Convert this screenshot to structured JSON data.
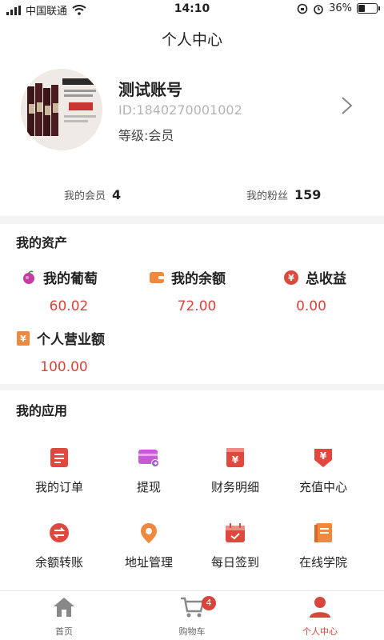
{
  "status_bar": {
    "carrier": "中国联通",
    "time": "14:10",
    "battery": "36%",
    "battery_level": 0.36
  },
  "header": {
    "title": "个人中心"
  },
  "profile": {
    "name": "测试账号",
    "id": "ID:1840270001002",
    "level": "等级:会员",
    "members_label": "我的会员",
    "members_count": "4",
    "fans_label": "我的粉丝",
    "fans_count": "159"
  },
  "assets": {
    "title": "我的资产",
    "items": [
      {
        "label": "我的葡萄",
        "value": "60.02",
        "icon": "grape-icon",
        "color": "#c23ea3"
      },
      {
        "label": "我的余额",
        "value": "72.00",
        "icon": "wallet-icon",
        "color": "#f0883e"
      },
      {
        "label": "总收益",
        "value": "0.00",
        "icon": "yen-coin-icon",
        "color": "#e0483d"
      },
      {
        "label": "个人营业额",
        "value": "100.00",
        "icon": "yen-tag-icon",
        "color": "#f0883e"
      }
    ]
  },
  "apps": {
    "title": "我的应用",
    "items": [
      {
        "label": "我的订单",
        "icon": "order-list-icon"
      },
      {
        "label": "提现",
        "icon": "withdraw-card-icon"
      },
      {
        "label": "财务明细",
        "icon": "finance-detail-icon"
      },
      {
        "label": "充值中心",
        "icon": "recharge-icon"
      },
      {
        "label": "余额转账",
        "icon": "transfer-icon"
      },
      {
        "label": "地址管理",
        "icon": "location-pin-icon"
      },
      {
        "label": "每日签到",
        "icon": "calendar-check-icon"
      },
      {
        "label": "在线学院",
        "icon": "book-icon"
      }
    ]
  },
  "tabbar": {
    "items": [
      {
        "label": "首页",
        "icon": "home-icon"
      },
      {
        "label": "购物车",
        "icon": "cart-icon",
        "badge": "4"
      },
      {
        "label": "个人中心",
        "icon": "user-icon",
        "active": true
      }
    ]
  },
  "colors": {
    "accent": "#d7453b",
    "background": "#f4f4f4"
  }
}
